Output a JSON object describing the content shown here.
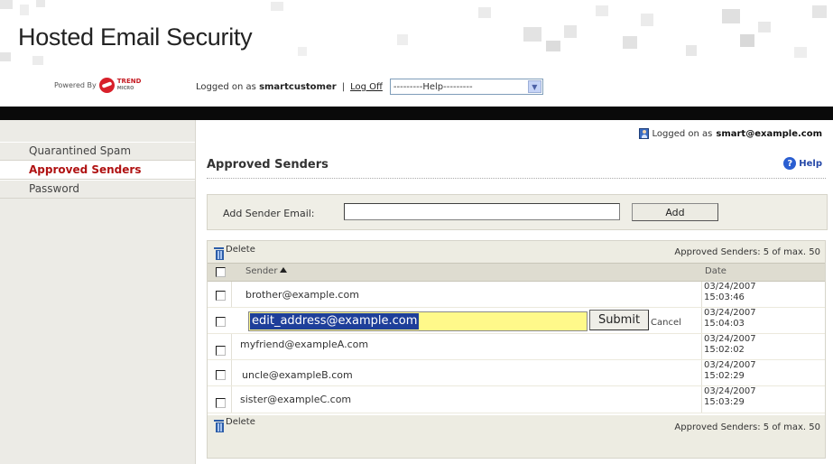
{
  "header": {
    "app_title": "Hosted Email Security",
    "powered_by": "Powered By",
    "brand_line1": "TREND",
    "brand_line2": "MICRO",
    "logged_on_prefix": "Logged on as",
    "username": "smartcustomer",
    "separator": "|",
    "log_off": "Log Off",
    "help_select_value": "---------Help---------"
  },
  "sidebar": {
    "items": [
      {
        "label": "Quarantined Spam",
        "active": false
      },
      {
        "label": "Approved Senders",
        "active": true
      },
      {
        "label": "Password",
        "active": false
      }
    ]
  },
  "main": {
    "user_line_prefix": "Logged on as",
    "user_email": "smart@example.com",
    "page_title": "Approved Senders",
    "help_label": "Help",
    "add_label": "Add Sender Email:",
    "add_input_value": "",
    "add_button": "Add"
  },
  "table": {
    "delete_label": "Delete",
    "count_text": "Approved Senders: 5 of max. 50",
    "col_sender": "Sender",
    "col_date": "Date",
    "rows": [
      {
        "sender": "brother@example.com",
        "date_line1": "03/24/2007",
        "date_line2": "15:03:46"
      },
      {
        "sender": "edit_address@example.com",
        "date_line1": "03/24/2007",
        "date_line2": "15:04:03"
      },
      {
        "sender": "myfriend@exampleA.com",
        "date_line1": "03/24/2007",
        "date_line2": "15:02:02"
      },
      {
        "sender": "uncle@exampleB.com",
        "date_line1": "03/24/2007",
        "date_line2": "15:02:29"
      },
      {
        "sender": "sister@exampleC.com",
        "date_line1": "03/24/2007",
        "date_line2": "15:03:29"
      }
    ],
    "submit_label": "Submit",
    "cancel_label": "Cancel"
  },
  "colors": {
    "active_nav": "#b01212",
    "edit_highlight": "#fff98a",
    "selection": "#1e3f9a",
    "help_blue": "#2548a8"
  }
}
